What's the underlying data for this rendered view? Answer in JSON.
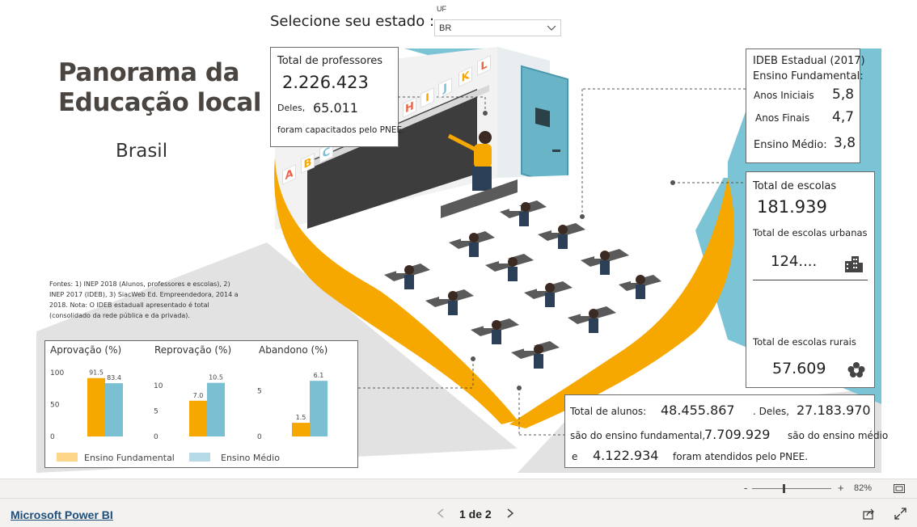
{
  "report": {
    "title_lines": [
      "Panorama da",
      "Educação local"
    ],
    "subtitle": "Brasil",
    "state_prompt": "Selecione seu estado :",
    "filter": {
      "label": "UF",
      "value": "BR"
    },
    "board_letters": [
      "A",
      "B",
      "C",
      "H",
      "I",
      "J",
      "K",
      "L"
    ]
  },
  "teachers": {
    "title": "Total de professores",
    "total": "2.226.423",
    "deles_label": "Deles,",
    "trained": "65.011",
    "note": "foram capacitados pelo PNEE."
  },
  "ideb": {
    "title_line1": "IDEB Estadual (2017)",
    "title_line2": "Ensino Fundamental:",
    "rows": [
      {
        "label": "Anos Iniciais",
        "value": "5,8"
      },
      {
        "label": "Anos Finais",
        "value": "4,7"
      },
      {
        "label": "Ensino Médio:",
        "value": "3,8"
      }
    ]
  },
  "schools": {
    "title": "Total de escolas",
    "total": "181.939",
    "urban_label": "Total de escolas urbanas",
    "urban_value": "124....",
    "rural_label": "Total de escolas rurais",
    "rural_value": "57.609"
  },
  "students": {
    "label_total": "Total de alunos:",
    "total": "48.455.867",
    "deles": ". Deles,",
    "fundamental": "27.183.970",
    "fundamental_text": "são do ensino fundamental,",
    "medio": "7.709.929",
    "medio_text": "são do ensino médio",
    "e": "e",
    "pnee": "4.122.934",
    "pnee_text": "foram atendidos pelo PNEE."
  },
  "sources_text": "Fontes: 1) INEP 2018 (Alunos, professores e escolas), 2) INEP 2017 (IDEB), 3) SiacWeb Ed. Empreendedora, 2014 a 2018. Nota: O IDEB estaduall apresentado é total (consolidado da rede pública e da privada).",
  "colors": {
    "fundamental": "#f7a800",
    "medio": "#7bbfd3",
    "accent": "#f7a800",
    "wall": "#7bc4d6"
  },
  "chart_data": [
    {
      "type": "bar",
      "title": "Aprovação (%)",
      "categories": [
        "Aprovação"
      ],
      "series": [
        {
          "name": "Ensino Fundamental",
          "values": [
            91.5
          ]
        },
        {
          "name": "Ensino Médio",
          "values": [
            83.4
          ]
        }
      ],
      "value_labels": [
        "91.5",
        "83.4"
      ],
      "yticks": [
        "100",
        "50",
        "0"
      ],
      "ylim": [
        0,
        100
      ]
    },
    {
      "type": "bar",
      "title": "Reprovação (%)",
      "categories": [
        "Reprovação"
      ],
      "series": [
        {
          "name": "Ensino Fundamental",
          "values": [
            7.0
          ]
        },
        {
          "name": "Ensino Médio",
          "values": [
            10.5
          ]
        }
      ],
      "value_labels": [
        "7.0",
        "10.5"
      ],
      "yticks": [
        "10",
        "5",
        "0"
      ],
      "ylim": [
        0,
        12.5
      ]
    },
    {
      "type": "bar",
      "title": "Abandono (%)",
      "categories": [
        "Abandono"
      ],
      "series": [
        {
          "name": "Ensino Fundamental",
          "values": [
            1.5
          ]
        },
        {
          "name": "Ensino Médio",
          "values": [
            6.1
          ]
        }
      ],
      "value_labels": [
        "1.5",
        "6.1"
      ],
      "yticks": [
        "5",
        "0"
      ],
      "ylim": [
        0,
        7
      ]
    }
  ],
  "legend": {
    "items": [
      "Ensino Fundamental",
      "Ensino Médio"
    ]
  },
  "viewer": {
    "zoom_minus": "-",
    "zoom_plus": "+",
    "zoom_level": "82%",
    "brand_link": "Microsoft Power BI",
    "page_indicator": "1 de 2"
  }
}
